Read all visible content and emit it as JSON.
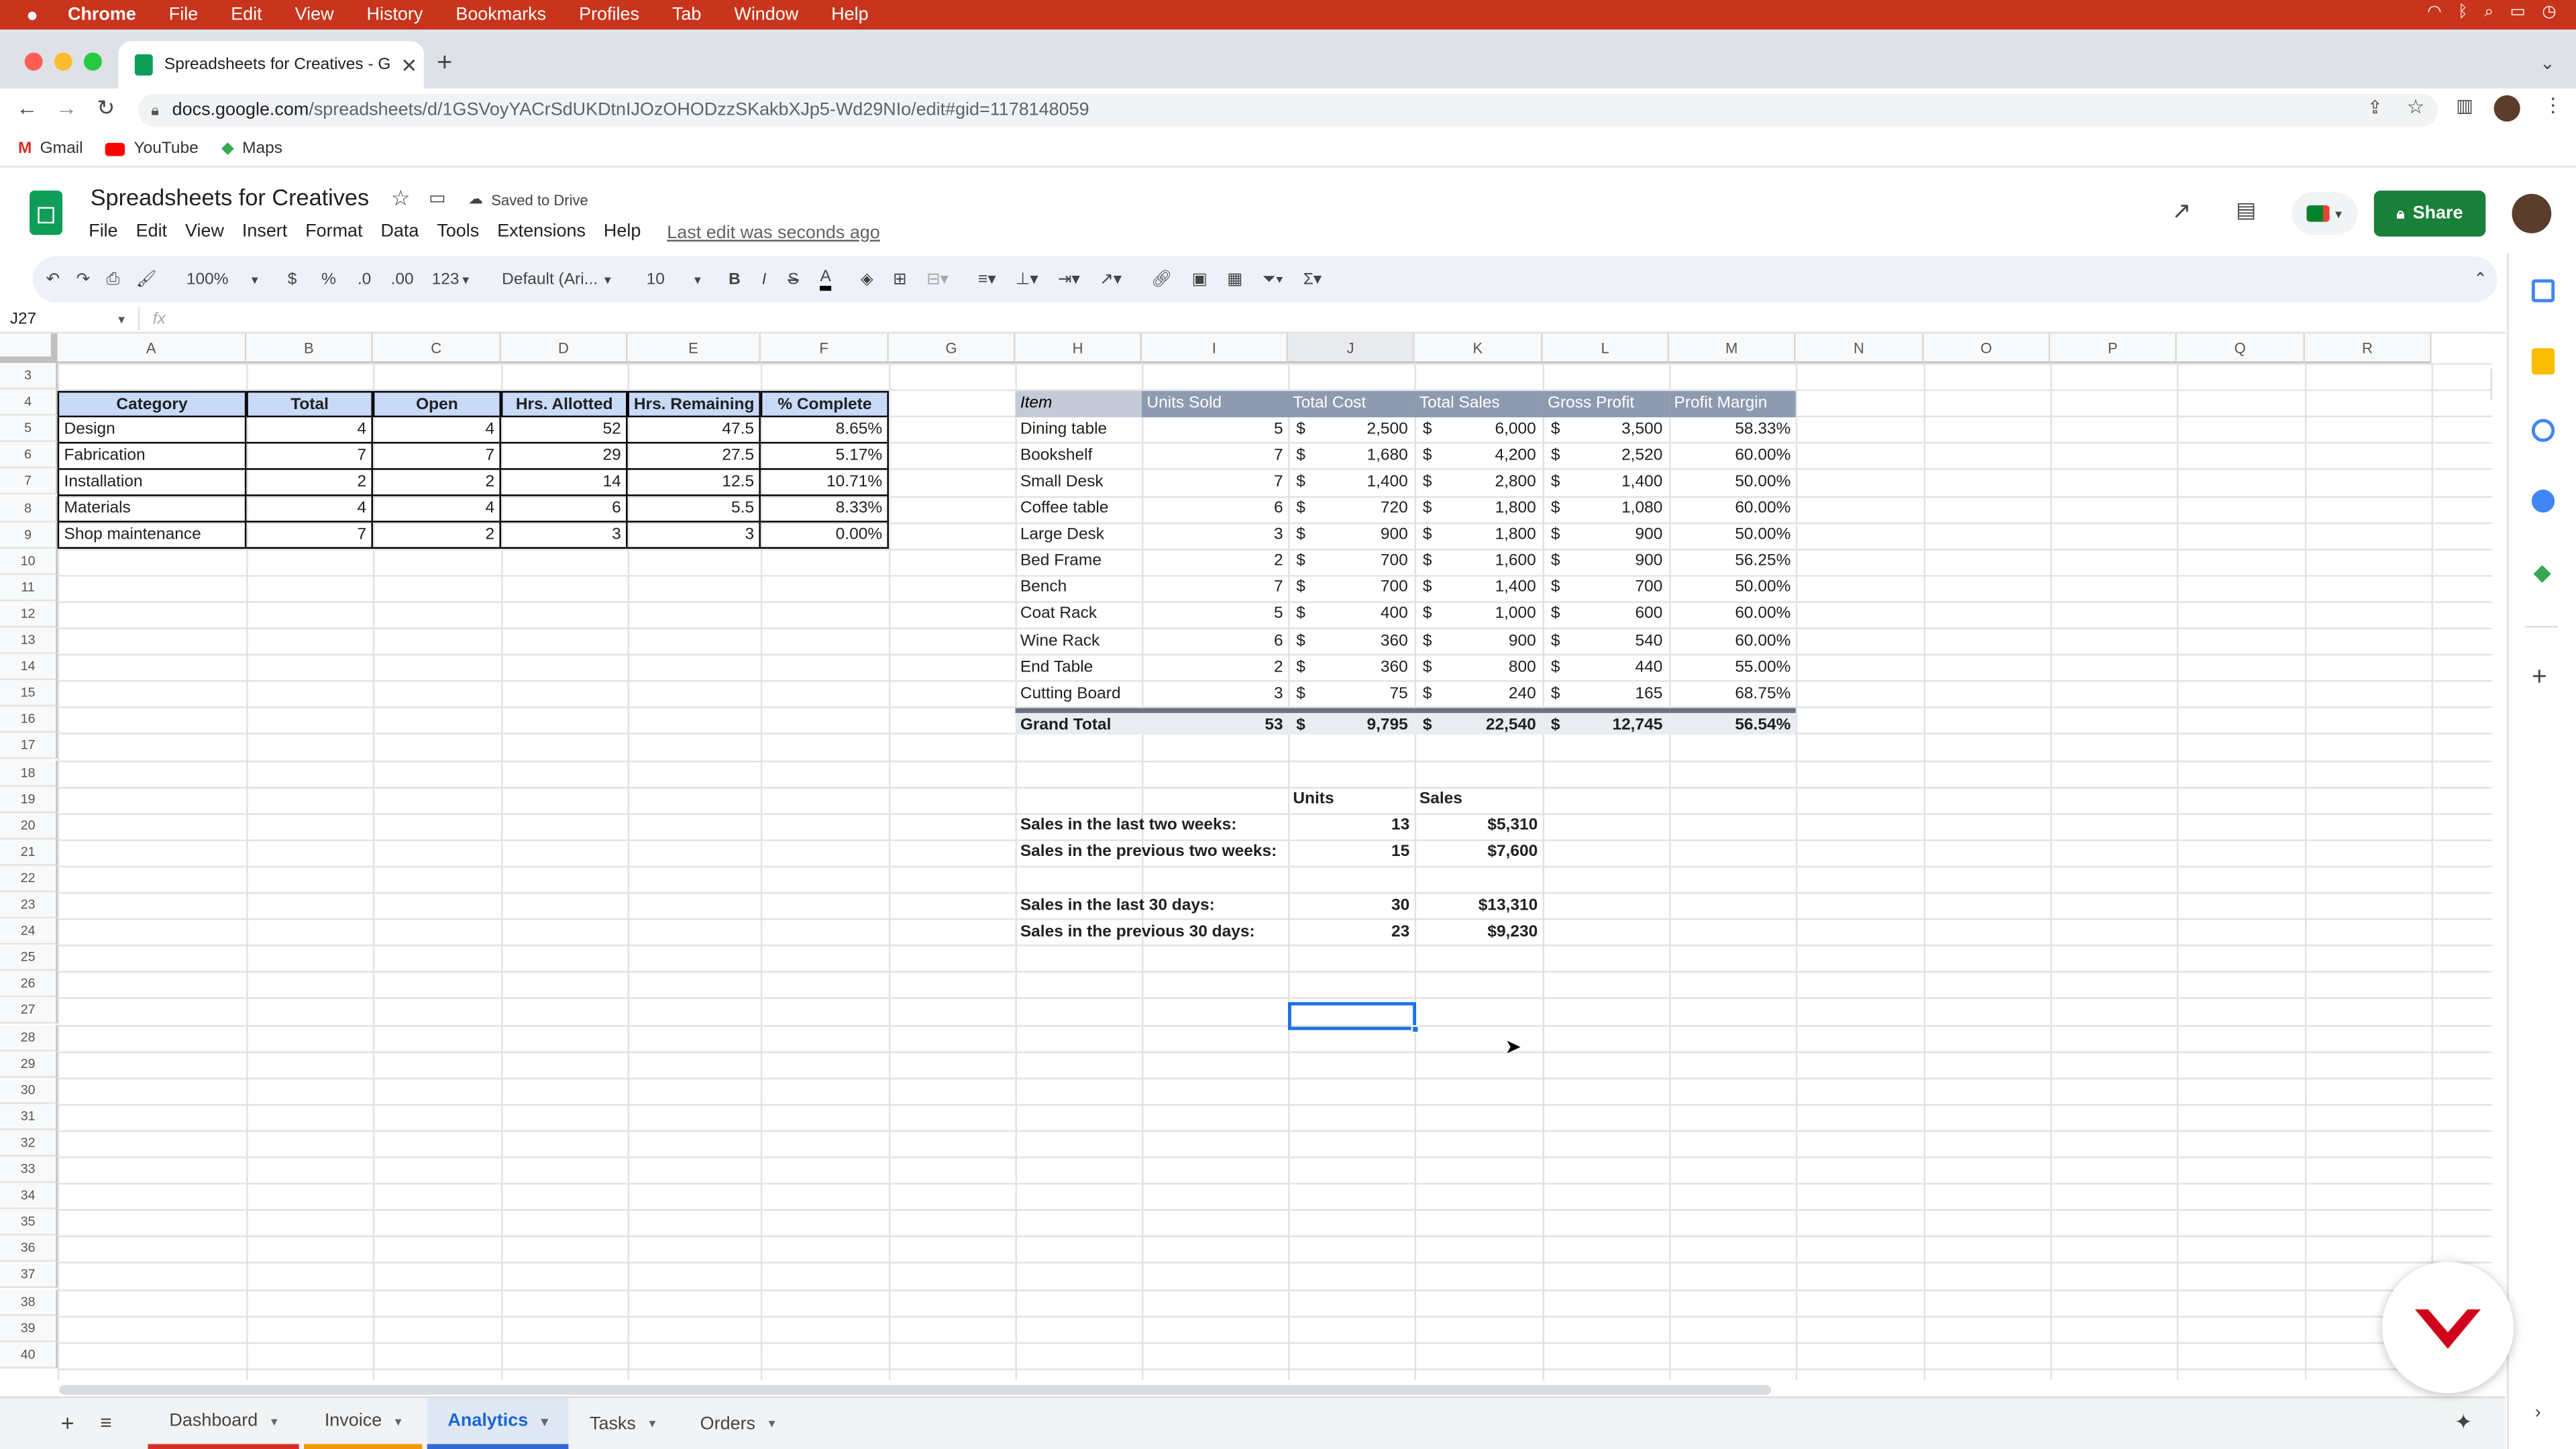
{
  "macbar": {
    "apple": "",
    "app": "Chrome",
    "menus": [
      "File",
      "Edit",
      "View",
      "History",
      "Bookmarks",
      "Profiles",
      "Tab",
      "Window",
      "Help"
    ]
  },
  "browser": {
    "tab_title": "Spreadsheets for Creatives - G",
    "url_host": "docs.google.com",
    "url_path": "/spreadsheets/d/1GSVoyYACrSdUKDtnIJOzOHODzzSKakbXJp5-Wd29NIo/edit#gid=1178148059",
    "bookmarks": [
      "Gmail",
      "YouTube",
      "Maps"
    ]
  },
  "sheets": {
    "doc_title": "Spreadsheets for Creatives",
    "saved": "Saved to Drive",
    "menus": [
      "File",
      "Edit",
      "View",
      "Insert",
      "Format",
      "Data",
      "Tools",
      "Extensions",
      "Help"
    ],
    "last_edit": "Last edit was seconds ago",
    "share": "Share",
    "toolbar": {
      "zoom": "100%",
      "currency": "$",
      "percent": "%",
      "dec_dec": ".0",
      "dec_inc": ".00",
      "format": "123",
      "font": "Default (Ari...",
      "size": "10"
    },
    "namebox": "J27",
    "fx": "fx"
  },
  "columns": [
    "A",
    "B",
    "C",
    "D",
    "E",
    "F",
    "G",
    "H",
    "I",
    "J",
    "K",
    "L",
    "M",
    "N",
    "O",
    "P",
    "Q",
    "R"
  ],
  "rows": [
    "3",
    "4",
    "5",
    "6",
    "7",
    "8",
    "9",
    "10",
    "11",
    "12",
    "13",
    "14",
    "15",
    "16",
    "17",
    "18",
    "19",
    "20",
    "21",
    "22",
    "23",
    "24",
    "25",
    "26",
    "27",
    "28",
    "29",
    "30",
    "31",
    "32",
    "33",
    "34",
    "35",
    "36",
    "37",
    "38",
    "39",
    "40"
  ],
  "table1": {
    "headers": [
      "Category",
      "Total",
      "Open",
      "Hrs. Allotted",
      "Hrs. Remaining",
      "% Complete"
    ],
    "rows": [
      [
        "Design",
        "4",
        "4",
        "52",
        "47.5",
        "8.65%"
      ],
      [
        "Fabrication",
        "7",
        "7",
        "29",
        "27.5",
        "5.17%"
      ],
      [
        "Installation",
        "2",
        "2",
        "14",
        "12.5",
        "10.71%"
      ],
      [
        "Materials",
        "4",
        "4",
        "6",
        "5.5",
        "8.33%"
      ],
      [
        "Shop maintenance",
        "7",
        "2",
        "3",
        "3",
        "0.00%"
      ]
    ]
  },
  "table2": {
    "headers": [
      "Item",
      "Units Sold",
      "Total Cost",
      "Total Sales",
      "Gross Profit",
      "Profit Margin"
    ],
    "dollar": "$",
    "rows": [
      [
        "Dining table",
        "5",
        "2,500",
        "6,000",
        "3,500",
        "58.33%"
      ],
      [
        "Bookshelf",
        "7",
        "1,680",
        "4,200",
        "2,520",
        "60.00%"
      ],
      [
        "Small Desk",
        "7",
        "1,400",
        "2,800",
        "1,400",
        "50.00%"
      ],
      [
        "Coffee table",
        "6",
        "720",
        "1,800",
        "1,080",
        "60.00%"
      ],
      [
        "Large Desk",
        "3",
        "900",
        "1,800",
        "900",
        "50.00%"
      ],
      [
        "Bed Frame",
        "2",
        "700",
        "1,600",
        "900",
        "56.25%"
      ],
      [
        "Bench",
        "7",
        "700",
        "1,400",
        "700",
        "50.00%"
      ],
      [
        "Coat Rack",
        "5",
        "400",
        "1,000",
        "600",
        "60.00%"
      ],
      [
        "Wine Rack",
        "6",
        "360",
        "900",
        "540",
        "60.00%"
      ],
      [
        "End Table",
        "2",
        "360",
        "800",
        "440",
        "55.00%"
      ],
      [
        "Cutting Board",
        "3",
        "75",
        "240",
        "165",
        "68.75%"
      ]
    ],
    "total": [
      "Grand Total",
      "53",
      "9,795",
      "22,540",
      "12,745",
      "56.54%"
    ]
  },
  "summary": {
    "headers": [
      "Units",
      "Sales"
    ],
    "rows": [
      [
        "Sales in the last two weeks:",
        "13",
        "$5,310"
      ],
      [
        "Sales in the previous two weeks:",
        "15",
        "$7,600"
      ],
      [
        "Sales in the last 30 days:",
        "30",
        "$13,310"
      ],
      [
        "Sales in the previous 30 days:",
        "23",
        "$9,230"
      ]
    ]
  },
  "sheet_tabs": [
    "Dashboard",
    "Invoice",
    "Analytics",
    "Tasks",
    "Orders"
  ],
  "active_tab": "Analytics",
  "colors": {
    "macbar": "#c8351c",
    "share": "#188038",
    "header_fill": "#8e9ab0",
    "table1_fill": "#c9daf8",
    "selection": "#1a73e8"
  }
}
